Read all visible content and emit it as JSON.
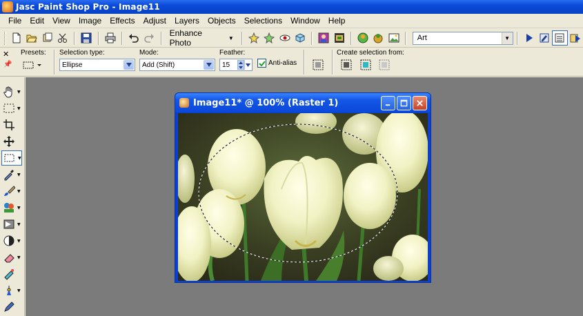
{
  "app": {
    "title": "Jasc Paint Shop Pro - Image11"
  },
  "menu": [
    "File",
    "Edit",
    "View",
    "Image",
    "Effects",
    "Adjust",
    "Layers",
    "Objects",
    "Selections",
    "Window",
    "Help"
  ],
  "toolbar": {
    "enhance_label": "Enhance Photo",
    "palette_value": "Art"
  },
  "tool_options": {
    "presets_label": "Presets:",
    "selection_type_label": "Selection type:",
    "selection_type_value": "Ellipse",
    "mode_label": "Mode:",
    "mode_value": "Add (Shift)",
    "feather_label": "Feather:",
    "feather_value": "15",
    "antialias_label": "Anti-alias",
    "antialias_checked": true,
    "create_selection_label": "Create selection from:"
  },
  "image_window": {
    "title": "Image11* @ 100% (Raster 1)"
  },
  "colors": {
    "workspace": "#7b7b7b",
    "title_blue": "#0a4ad8",
    "chrome": "#ece9d8"
  }
}
